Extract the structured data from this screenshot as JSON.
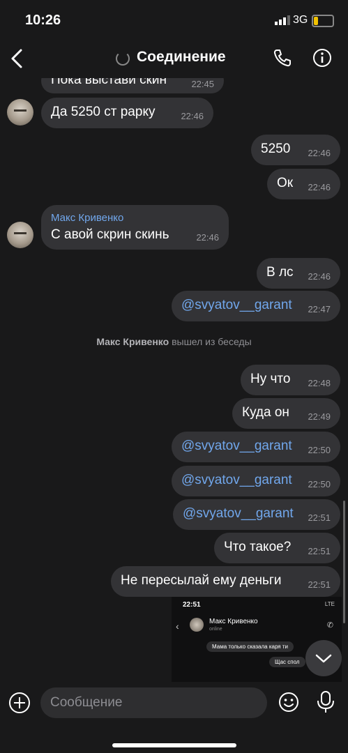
{
  "status_bar": {
    "time": "10:26",
    "network": "3G",
    "battery_level": 0.2,
    "battery_color": "#f2c200"
  },
  "header": {
    "title": "Соединение",
    "back_icon": "chevron-left-icon",
    "call_icon": "phone-icon",
    "info_icon": "info-icon"
  },
  "messages": [
    {
      "text": "Пока выстави скин",
      "time": "22:45",
      "incoming": true
    },
    {
      "text": "Да 5250 ст рарку",
      "time": "22:46",
      "incoming": true
    },
    {
      "text": "5250",
      "time": "22:46",
      "incoming": false
    },
    {
      "text": "Ок",
      "time": "22:46",
      "incoming": false
    },
    {
      "sender": "Макс Кривенко",
      "text": "С авой скрин скинь",
      "time": "22:46",
      "incoming": true
    },
    {
      "text": "В лс",
      "time": "22:46",
      "incoming": false
    },
    {
      "text": "@svyatov__garant",
      "time": "22:47",
      "incoming": false,
      "mention": true
    },
    {
      "text": "Ну что",
      "time": "22:48",
      "incoming": false
    },
    {
      "text": "Куда он",
      "time": "22:49",
      "incoming": false
    },
    {
      "text": "@svyatov__garant",
      "time": "22:50",
      "incoming": false,
      "mention": true
    },
    {
      "text": "@svyatov__garant",
      "time": "22:50",
      "incoming": false,
      "mention": true
    },
    {
      "text": "@svyatov__garant",
      "time": "22:51",
      "incoming": false,
      "mention": true
    },
    {
      "text": "Что такое?",
      "time": "22:51",
      "incoming": false
    },
    {
      "text": "Не пересылай ему деньги",
      "time": "22:51",
      "incoming": false
    }
  ],
  "system_message": {
    "name": "Макс Кривенко",
    "text": "вышел из беседы"
  },
  "screenshot": {
    "time": "22:51",
    "network": "LTE",
    "contact_name": "Макс Кривенко",
    "contact_status": "online",
    "bubble1": "Мама только сказала каря ти",
    "bubble2": "Щас спол"
  },
  "composer": {
    "placeholder": "Сообщение",
    "attach_icon": "plus-circle-icon",
    "emoji_icon": "smile-icon",
    "mic_icon": "microphone-icon"
  },
  "colors": {
    "background": "#19191a",
    "bubble": "#333336",
    "link": "#71a7ec"
  }
}
